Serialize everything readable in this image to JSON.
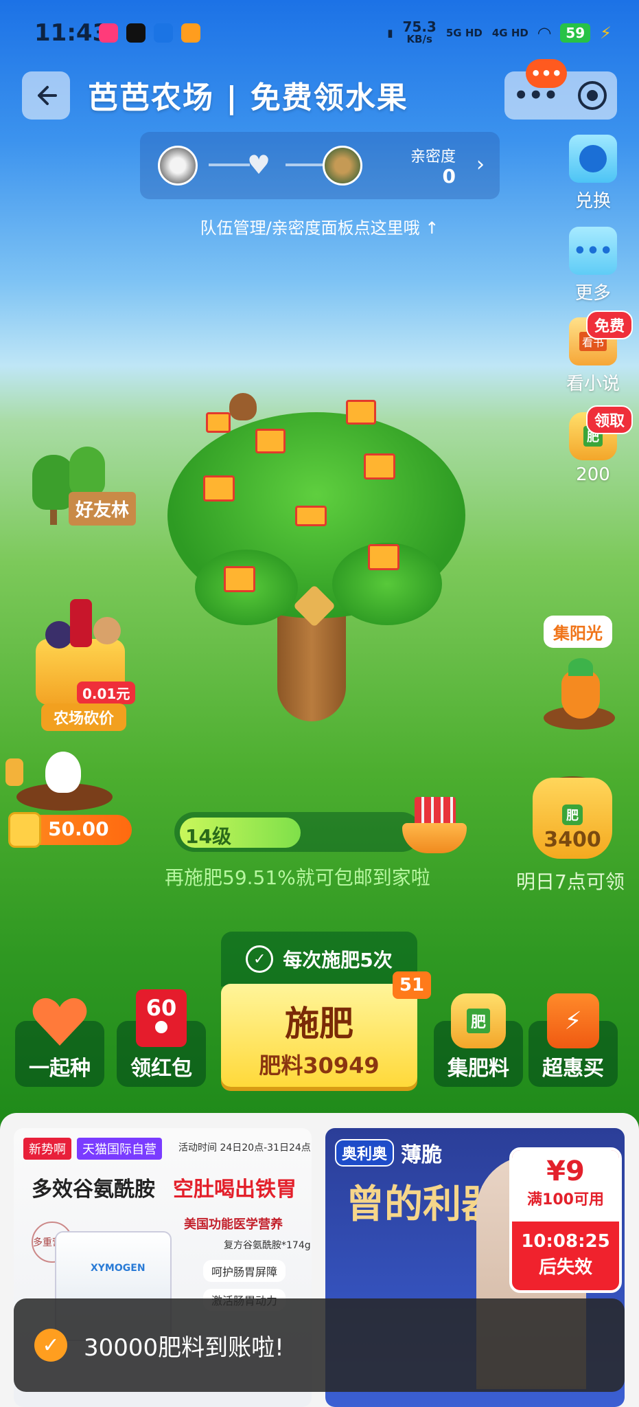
{
  "status_bar": {
    "time": "11:43",
    "net_speed": "75.3",
    "net_unit": "KB/s",
    "signal1": "5G HD",
    "signal2": "4G HD",
    "battery": "59"
  },
  "header": {
    "title": "芭芭农场 | 免费领水果",
    "notif_dots": "•••"
  },
  "intimacy": {
    "label": "亲密度",
    "value": "0",
    "hint": "队伍管理/亲密度面板点这里哦 ↑"
  },
  "side": {
    "exchange": "兑换",
    "more": "更多",
    "novel": "看小说",
    "novel_tag": "免费",
    "novel_book": "看书",
    "fert_tag": "领取",
    "fert_amount": "200",
    "fert_char": "肥",
    "sunlight": "集阳光"
  },
  "scene": {
    "friend_forest": "好友林",
    "bargain_price": "0.01元",
    "bargain_label": "农场砍价",
    "coin_value": "50.00"
  },
  "progress": {
    "level": "14级",
    "message": "再施肥59.51%就可包邮到家啦",
    "percent": 40.49
  },
  "bag": {
    "tag": "肥",
    "amount": "3400",
    "note": "明日7点可领"
  },
  "actions": {
    "each_time": "每次施肥5次",
    "plant_together": "一起种",
    "red_packet": "领红包",
    "red_packet_amount": "60",
    "fertilize": "施肥",
    "fertilize_sub": "肥料30949",
    "badge": "51",
    "collect_fert": "集肥料",
    "super_buy": "超惠买"
  },
  "ad1": {
    "tag1": "新势啊",
    "tag2": "天猫国际自营",
    "time": "活动时间 24日20点-31日24点",
    "headline_a": "多效谷氨酰胺",
    "headline_b": "空肚喝出铁胃",
    "sub": "美国功能医学营养",
    "product": "复方谷氨酰胺*174g",
    "benefit1": "呵护肠胃屏障",
    "benefit2": "激活肠胃动力",
    "badge": "多重营养",
    "brand": "XYMOGEN"
  },
  "ad2": {
    "brand": "奥利奥",
    "product": "薄脆",
    "slogan": "曾的利器",
    "coupon_amount": "¥9",
    "coupon_cond": "满100可用",
    "coupon_time": "10:08:25",
    "coupon_expire": "后失效"
  },
  "toast": {
    "text": "30000肥料到账啦!"
  },
  "colors": {
    "accent_orange": "#ff7a1a",
    "red": "#ef2f3a",
    "fert_yellow": "#ffd93a"
  }
}
